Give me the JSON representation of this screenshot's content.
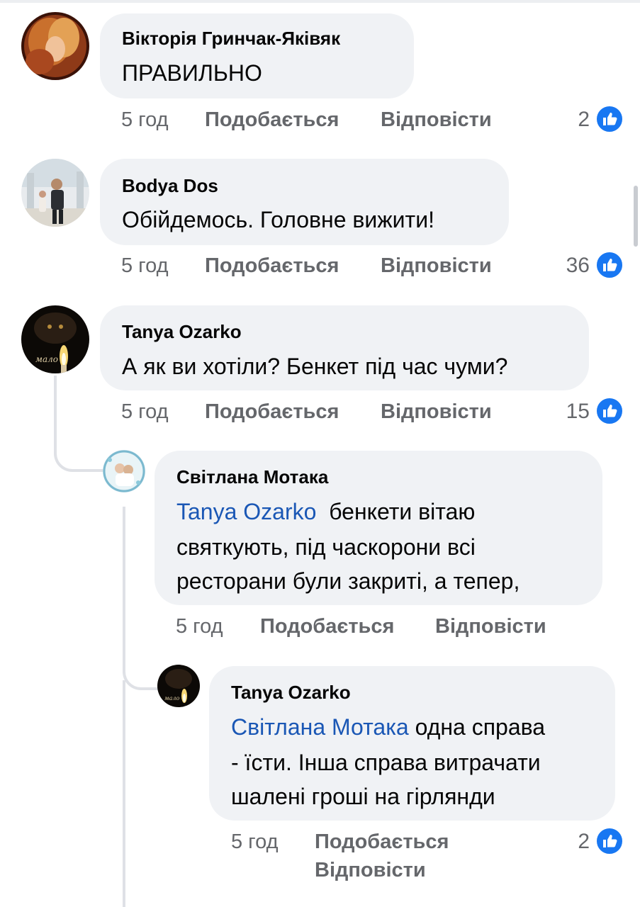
{
  "comments": [
    {
      "author": "Вікторія Гринчак-Яківяк",
      "text": "ПРАВИЛЬНО",
      "time": "5 год",
      "like_label": "Подобається",
      "reply_label": "Відповісти",
      "like_count": "2"
    },
    {
      "author": "Bodya Dos",
      "text": "Обійдемось. Головне вижити!",
      "time": "5 год",
      "like_label": "Подобається",
      "reply_label": "Відповісти",
      "like_count": "36"
    },
    {
      "author": "Tanya Ozarko",
      "text": "А як ви хотіли? Бенкет під час чуми?",
      "time": "5 год",
      "like_label": "Подобається",
      "reply_label": "Відповісти",
      "like_count": "15",
      "avatar_caption": "мало"
    },
    {
      "author": "Світлана Мотака",
      "mention": "Tanya Ozarko",
      "text_lines": [
        "бенкети вітаю",
        "святкують, під часкорони всі",
        "ресторани були закриті, а тепер,"
      ],
      "time": "5 год",
      "like_label": "Подобається",
      "reply_label": "Відповісти"
    },
    {
      "author": "Tanya Ozarko",
      "mention": "Світлана Мотака",
      "text_lines": [
        "одна справа",
        "- їсти. Інша справа витрачати",
        "шалені гроші на гірлянди"
      ],
      "time": "5 год",
      "like_label": "Подобається",
      "reply_label": "Відповісти",
      "like_count": "2",
      "avatar_caption": "мало"
    }
  ],
  "colors": {
    "bubble": "#f0f2f5",
    "meta_text": "#65676b",
    "mention": "#1a57b5",
    "like_badge": "#1877f2"
  },
  "icons": [
    "thumbs-up-icon",
    "avatar"
  ]
}
